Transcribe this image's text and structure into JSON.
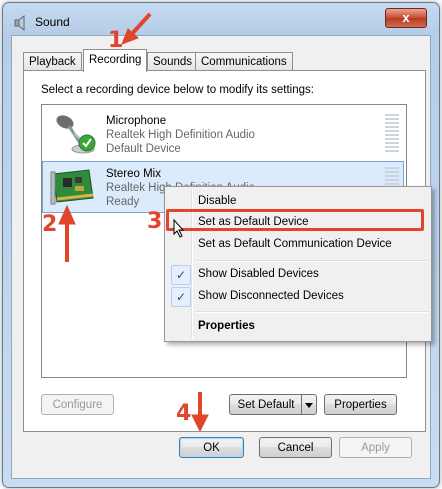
{
  "window": {
    "title": "Sound",
    "close_label": "x"
  },
  "tabs": [
    {
      "label": "Playback",
      "active": false
    },
    {
      "label": "Recording",
      "active": true
    },
    {
      "label": "Sounds",
      "active": false
    },
    {
      "label": "Communications",
      "active": false
    }
  ],
  "instruction": "Select a recording device below to modify its settings:",
  "devices": [
    {
      "name": "Microphone",
      "driver": "Realtek High Definition Audio",
      "status": "Default Device",
      "icon": "microphone-icon",
      "selected": false,
      "default_badge": true
    },
    {
      "name": "Stereo Mix",
      "driver": "Realtek High Definition Audio",
      "status": "Ready",
      "icon": "sound-card-icon",
      "selected": true,
      "default_badge": false
    }
  ],
  "context_menu": {
    "items": [
      {
        "label": "Disable",
        "checked": false,
        "bold": false
      },
      {
        "label": "Set as Default Device",
        "checked": false,
        "bold": false,
        "highlighted": true
      },
      {
        "label": "Set as Default Communication Device",
        "checked": false,
        "bold": false
      },
      {
        "label": "Show Disabled Devices",
        "checked": true,
        "bold": false
      },
      {
        "label": "Show Disconnected Devices",
        "checked": true,
        "bold": false
      },
      {
        "label": "Properties",
        "checked": false,
        "bold": true
      }
    ]
  },
  "panel_buttons": {
    "configure": "Configure",
    "set_default": "Set Default",
    "properties": "Properties"
  },
  "dialog_buttons": {
    "ok": "OK",
    "cancel": "Cancel",
    "apply": "Apply"
  },
  "annotations": {
    "step1": "1",
    "step2": "2",
    "step3": "3",
    "step4": "4",
    "color": "#e1452c"
  },
  "check_glyph": "✓"
}
